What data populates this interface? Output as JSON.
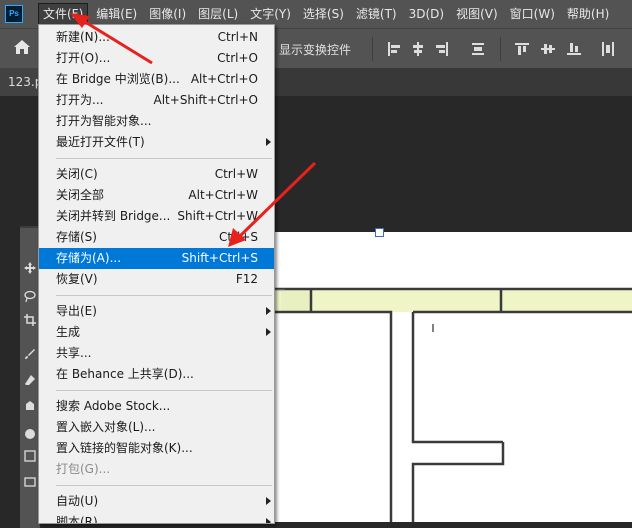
{
  "app": {
    "logo_text": "Ps"
  },
  "menubar": {
    "items": [
      "文件(F)",
      "编辑(E)",
      "图像(I)",
      "图层(L)",
      "文字(Y)",
      "选择(S)",
      "滤镜(T)",
      "3D(D)",
      "视图(V)",
      "窗口(W)",
      "帮助(H)"
    ]
  },
  "optionsbar": {
    "transform_label": "显示变换控件"
  },
  "tabbar": {
    "doc_tab": "123.p"
  },
  "file_menu": {
    "items": [
      {
        "label": "新建(N)...",
        "shortcut": "Ctrl+N"
      },
      {
        "label": "打开(O)...",
        "shortcut": "Ctrl+O"
      },
      {
        "label": "在 Bridge 中浏览(B)...",
        "shortcut": "Alt+Ctrl+O"
      },
      {
        "label": "打开为...",
        "shortcut": "Alt+Shift+Ctrl+O"
      },
      {
        "label": "打开为智能对象...",
        "shortcut": ""
      },
      {
        "label": "最近打开文件(T)",
        "shortcut": "",
        "submenu": true
      },
      {
        "label": "关闭(C)",
        "shortcut": "Ctrl+W"
      },
      {
        "label": "关闭全部",
        "shortcut": "Alt+Ctrl+W"
      },
      {
        "label": "关闭并转到 Bridge...",
        "shortcut": "Shift+Ctrl+W"
      },
      {
        "label": "存储(S)",
        "shortcut": "Ctrl+S"
      },
      {
        "label": "存储为(A)...",
        "shortcut": "Shift+Ctrl+S",
        "selected": true
      },
      {
        "label": "恢复(V)",
        "shortcut": "F12"
      },
      {
        "label": "导出(E)",
        "shortcut": "",
        "submenu": true
      },
      {
        "label": "生成",
        "shortcut": "",
        "submenu": true
      },
      {
        "label": "共享...",
        "shortcut": ""
      },
      {
        "label": "在 Behance 上共享(D)...",
        "shortcut": ""
      },
      {
        "label": "搜索 Adobe Stock...",
        "shortcut": ""
      },
      {
        "label": "置入嵌入对象(L)...",
        "shortcut": ""
      },
      {
        "label": "置入链接的智能对象(K)...",
        "shortcut": ""
      },
      {
        "label": "打包(G)...",
        "shortcut": "",
        "disabled": true
      },
      {
        "label": "自动(U)",
        "shortcut": "",
        "submenu": true
      },
      {
        "label": "脚本(R)",
        "shortcut": "",
        "submenu": true
      }
    ]
  },
  "colors": {
    "selection": "#0078d7",
    "annotation_arrow": "#e8211d",
    "menubar_bg": "#535353"
  }
}
